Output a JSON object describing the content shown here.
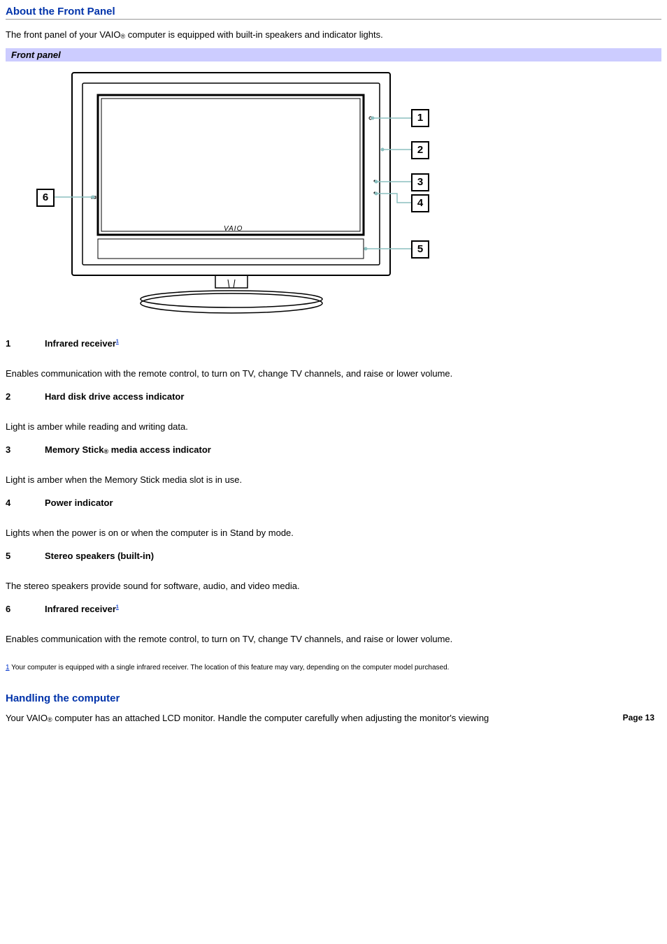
{
  "section1": {
    "title": "About the Front Panel",
    "intro_pre": "The front panel of your VAIO",
    "intro_post": " computer is equipped with built-in speakers and indicator lights.",
    "panel_header": "Front panel"
  },
  "diagram": {
    "logo": "VAIO",
    "callouts": {
      "1": "1",
      "2": "2",
      "3": "3",
      "4": "4",
      "5": "5",
      "6": "6"
    }
  },
  "items": [
    {
      "num": "1",
      "label": "Infrared receiver",
      "footref": "1",
      "desc": "Enables communication with the remote control, to turn on TV, change TV channels, and raise or lower volume."
    },
    {
      "num": "2",
      "label": "Hard disk drive access indicator",
      "footref": "",
      "desc": "Light is amber while reading and writing data."
    },
    {
      "num": "3",
      "label_pre": "Memory Stick",
      "label_post": " media access indicator",
      "reg": "®",
      "footref": "",
      "desc": "Light is amber when the Memory Stick media slot is in use."
    },
    {
      "num": "4",
      "label": "Power indicator",
      "footref": "",
      "desc": "Lights when the power is on or when the computer is in Stand by mode."
    },
    {
      "num": "5",
      "label": "Stereo speakers (built-in)",
      "footref": "",
      "desc": "The stereo speakers provide sound for software, audio, and video media."
    },
    {
      "num": "6",
      "label": "Infrared receiver",
      "footref": "1",
      "desc": "Enables communication with the remote control, to turn on TV, change TV channels, and raise or lower volume."
    }
  ],
  "footnote": {
    "marker": "1",
    "text": " Your computer is equipped with a single infrared receiver. The location of this feature may vary, depending on the computer model purchased."
  },
  "section2": {
    "title": "Handling the computer",
    "body_pre": "Your VAIO",
    "body_post": " computer has an attached LCD monitor. Handle the computer carefully when adjusting the monitor's viewing"
  },
  "page_label": "Page 13",
  "reg_symbol": "®"
}
